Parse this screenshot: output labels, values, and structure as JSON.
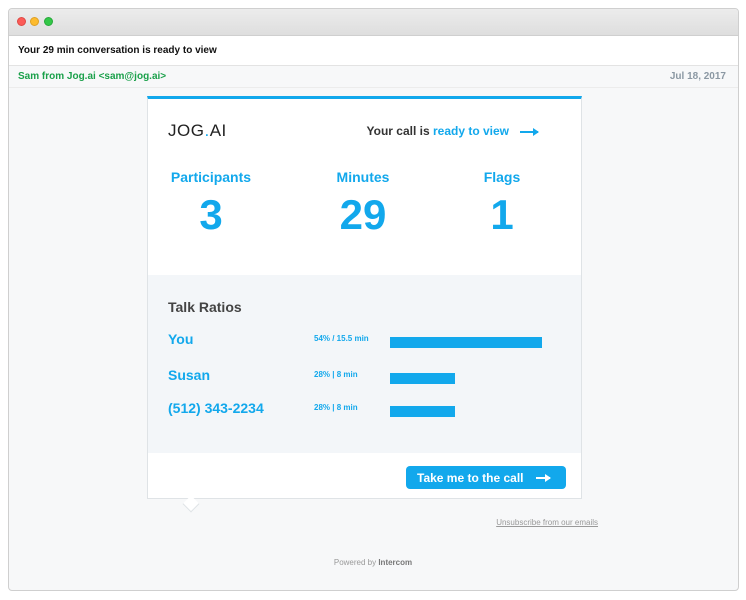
{
  "email": {
    "subject": "Your 29 min conversation is ready to view",
    "sender": "Sam from Jog.ai <sam@jog.ai>",
    "date": "Jul 18, 2017"
  },
  "card": {
    "logo_left": "JOG",
    "logo_dot": ".",
    "logo_right": "AI",
    "ready_prefix": "Your call is ",
    "ready_link": "ready to view",
    "stats": [
      {
        "label": "Participants",
        "value": "3"
      },
      {
        "label": "Minutes",
        "value": "29"
      },
      {
        "label": "Flags",
        "value": "1"
      }
    ],
    "ratios_title": "Talk Ratios",
    "ratios": [
      {
        "name": "You",
        "text": "54% / 15.5 min",
        "fraction": 1.0
      },
      {
        "name": "Susan",
        "text": "28% | 8 min",
        "fraction": 0.43
      },
      {
        "name": "(512) 343-2234",
        "text": "28% | 8 min",
        "fraction": 0.43
      }
    ],
    "cta_label": "Take me to the call"
  },
  "footer": {
    "unsubscribe": "Unsubscribe from our emails",
    "powered_prefix": "Powered by ",
    "powered_brand": "Intercom"
  },
  "colors": {
    "accent": "#12a8ec",
    "sender_green": "#1aa04a"
  }
}
